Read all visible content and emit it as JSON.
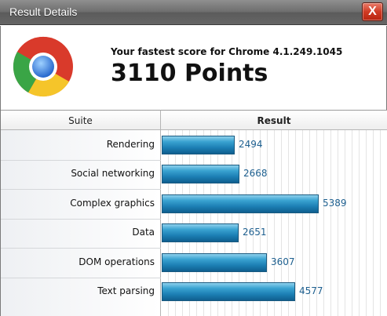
{
  "window": {
    "title": "Result Details",
    "close_label": "X"
  },
  "header": {
    "logo_icon": "chrome-logo-icon",
    "subtitle": "Your fastest score for Chrome 4.1.249.1045",
    "score": "3110 Points"
  },
  "table": {
    "columns": [
      "Suite",
      "Result"
    ],
    "rows": [
      {
        "suite": "Rendering",
        "value": "2494"
      },
      {
        "suite": "Social networking",
        "value": "2668"
      },
      {
        "suite": "Complex graphics",
        "value": "5389"
      },
      {
        "suite": "Data",
        "value": "2651"
      },
      {
        "suite": "DOM operations",
        "value": "3607"
      },
      {
        "suite": "Text parsing",
        "value": "4577"
      }
    ]
  },
  "colors": {
    "bar": "#1c7fb4",
    "value_text": "#1d5f8f",
    "close": "#cf3b24"
  }
}
